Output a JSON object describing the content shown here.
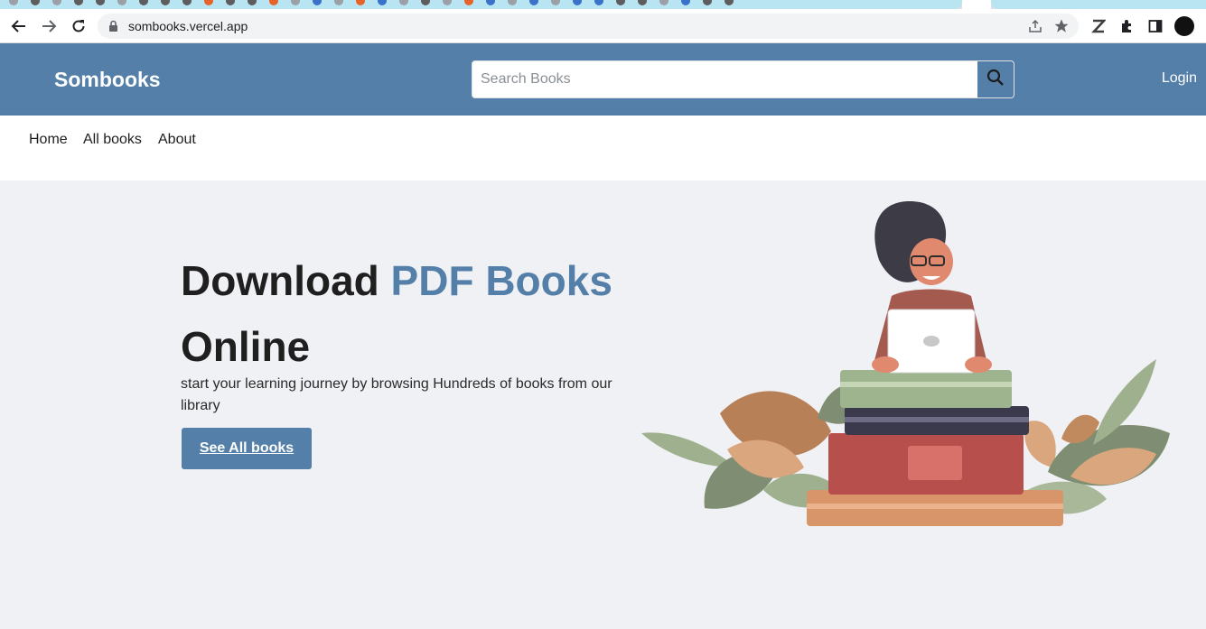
{
  "browser": {
    "url": "sombooks.vercel.app",
    "icons": {
      "back": "arrow-left-icon",
      "forward": "arrow-right-icon",
      "reload": "reload-icon",
      "lock": "lock-icon",
      "share": "share-icon",
      "bookmark": "star-icon",
      "extension_z": "z-extension-icon",
      "extensions": "puzzle-icon",
      "sidepanel": "side-panel-icon",
      "profile": "profile-avatar-icon"
    }
  },
  "header": {
    "brand": "Sombooks",
    "search_placeholder": "Search Books",
    "login": "Login",
    "search_icon": "search-icon"
  },
  "nav": {
    "items": [
      "Home",
      "All books",
      "About"
    ]
  },
  "hero": {
    "title_main": "Download ",
    "title_accent": "PDF Books",
    "title_rest": "Online",
    "subtitle": "start your learning journey by browsing Hundreds of books from our library",
    "cta": "See All books"
  },
  "colors": {
    "primary": "#537fa8",
    "page_bg": "#f0f1f5",
    "text_dark": "#1f1f1f"
  }
}
